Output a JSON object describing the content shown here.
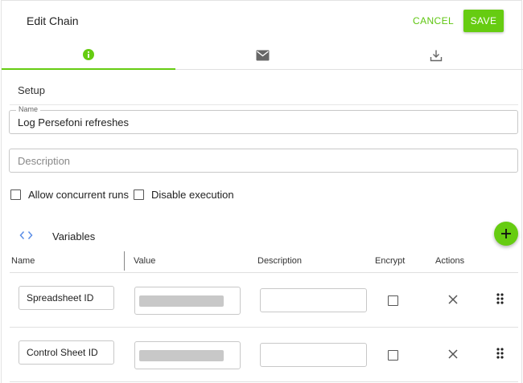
{
  "header": {
    "title": "Edit Chain",
    "cancel_label": "CANCEL",
    "save_label": "SAVE"
  },
  "tabs": [
    {
      "icon": "info-icon",
      "active": true
    },
    {
      "icon": "mail-icon",
      "active": false
    },
    {
      "icon": "download-icon",
      "active": false
    }
  ],
  "setup": {
    "heading": "Setup",
    "name_label": "Name",
    "name_value": "Log Persefoni refreshes",
    "description_placeholder": "Description"
  },
  "options": {
    "allow_concurrent_label": "Allow concurrent runs",
    "disable_execution_label": "Disable execution"
  },
  "variables": {
    "heading": "Variables",
    "columns": [
      "Name",
      "Value",
      "Description",
      "Encrypt",
      "Actions"
    ],
    "rows": [
      {
        "name": "Spreadsheet ID",
        "value_masked": true,
        "description": "",
        "encrypt": false
      },
      {
        "name": "Control Sheet ID",
        "value_masked": true,
        "description": "",
        "encrypt": false
      }
    ]
  },
  "colors": {
    "accent": "#66cc11",
    "link": "#5b8ee6"
  }
}
